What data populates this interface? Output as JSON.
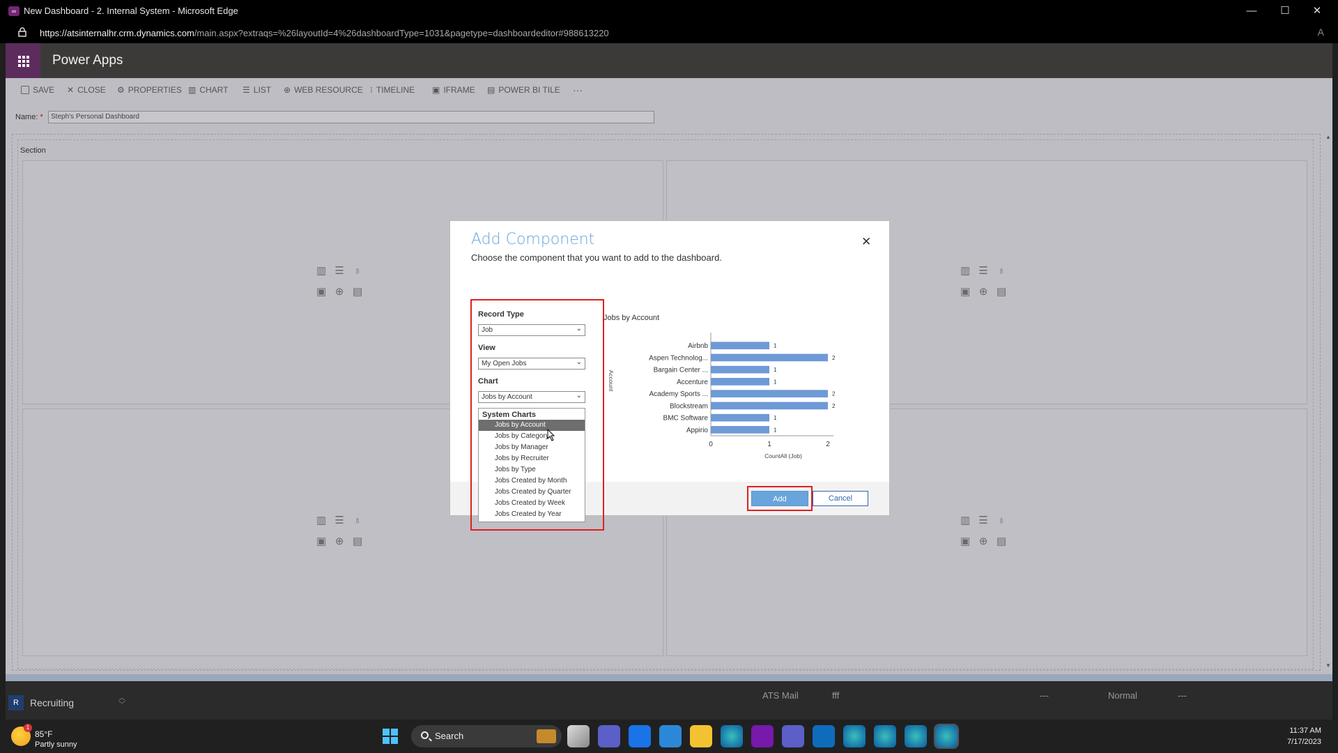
{
  "window": {
    "title": "New Dashboard - 2. Internal System - Microsoft Edge",
    "url_domain": "https://atsinternalhr.crm.dynamics.com",
    "url_path": "/main.aspx?extraqs=%26layoutId=4%26dashboardType=1031&pagetype=dashboardeditor#988613220"
  },
  "app": {
    "brand": "Power Apps"
  },
  "toolbar": {
    "save": "SAVE",
    "close": "CLOSE",
    "properties": "PROPERTIES",
    "chart": "CHART",
    "list": "LIST",
    "web_resource": "WEB RESOURCE",
    "timeline": "TIMELINE",
    "iframe": "IFRAME",
    "power_bi_tile": "POWER BI TILE",
    "more": "···"
  },
  "name_field": {
    "label": "Name:",
    "required": "*",
    "value": "Steph's Personal Dashboard"
  },
  "section_label": "Section",
  "dialog": {
    "title": "Add Component",
    "subtitle": "Choose the component that you want to add to the dashboard.",
    "close": "✕",
    "record_type": {
      "label": "Record Type",
      "value": "Job"
    },
    "view": {
      "label": "View",
      "value": "My Open Jobs"
    },
    "chart": {
      "label": "Chart",
      "value": "Jobs by Account"
    },
    "dropdown": {
      "group": "System Charts",
      "options": [
        "Jobs by Account",
        "Jobs by Category",
        "Jobs by Manager",
        "Jobs by Recruiter",
        "Jobs by Type",
        "Jobs Created by Month",
        "Jobs Created by Quarter",
        "Jobs Created by Week",
        "Jobs Created by Year"
      ],
      "selected_index": 0
    },
    "preview_title": "Jobs by Account",
    "add": "Add",
    "cancel": "Cancel"
  },
  "chart_data": {
    "type": "bar",
    "orientation": "horizontal",
    "title": "Jobs by Account",
    "categories": [
      "Airbnb",
      "Aspen Technolog...",
      "Bargain Center ...",
      "Accenture",
      "Academy Sports ...",
      "Blockstream",
      "BMC Software",
      "Appirio"
    ],
    "values": [
      1,
      2,
      1,
      1,
      2,
      2,
      1,
      1
    ],
    "xlabel": "CountAll (Job)",
    "ylabel": "Account",
    "xlim": [
      0,
      2
    ],
    "xticks": [
      "0",
      "1",
      "2"
    ],
    "color": "#6e9ad6"
  },
  "status": {
    "area": "Recruiting",
    "area_badge": "R",
    "ats_mail": "ATS Mail",
    "fff": "fff",
    "dash1": "---",
    "normal": "Normal",
    "dash2": "---"
  },
  "taskbar": {
    "temp": "85°F",
    "condition": "Partly sunny",
    "alert": "1",
    "search": "Search",
    "time": "11:37 AM",
    "date": "7/17/2023"
  }
}
